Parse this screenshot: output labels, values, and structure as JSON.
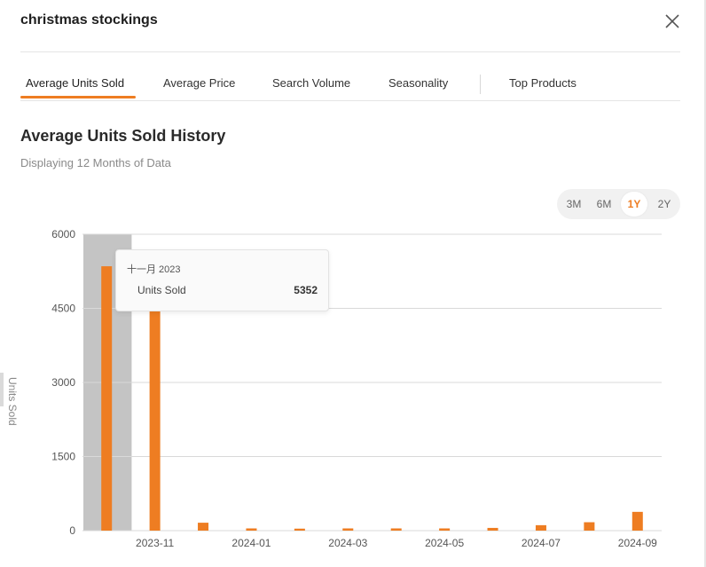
{
  "header": {
    "title": "christmas stockings"
  },
  "tabs": [
    {
      "label": "Average Units Sold",
      "active": true
    },
    {
      "label": "Average Price",
      "active": false
    },
    {
      "label": "Search Volume",
      "active": false
    },
    {
      "label": "Seasonality",
      "active": false
    },
    {
      "label": "Top Products",
      "active": false
    }
  ],
  "section": {
    "title": "Average Units Sold History",
    "subtitle": "Displaying 12 Months of Data"
  },
  "range": {
    "options": [
      "3M",
      "6M",
      "1Y",
      "2Y"
    ],
    "selected": "1Y"
  },
  "tooltip": {
    "date": "十一月 2023",
    "label": "Units Sold",
    "value": "5352"
  },
  "colors": {
    "accent": "#ee7d22",
    "bar": "#ee7d22",
    "highlight": "#c4c4c4",
    "grid": "#d9d9d9"
  },
  "chart_data": {
    "type": "bar",
    "ylabel": "Units Sold",
    "ylim": [
      0,
      6000
    ],
    "yticks": [
      0,
      1500,
      3000,
      4500,
      6000
    ],
    "xtick_labels": [
      "2023-11",
      "2024-01",
      "2024-03",
      "2024-05",
      "2024-07",
      "2024-09"
    ],
    "categories": [
      "2023-10",
      "2023-11",
      "2023-12",
      "2024-01",
      "2024-02",
      "2024-03",
      "2024-04",
      "2024-05",
      "2024-06",
      "2024-07",
      "2024-08",
      "2024-09"
    ],
    "series": [
      {
        "values": [
          5352,
          4550,
          160,
          45,
          40,
          45,
          45,
          45,
          55,
          110,
          170,
          380
        ]
      }
    ],
    "highlighted_index": 0,
    "grid": true
  }
}
